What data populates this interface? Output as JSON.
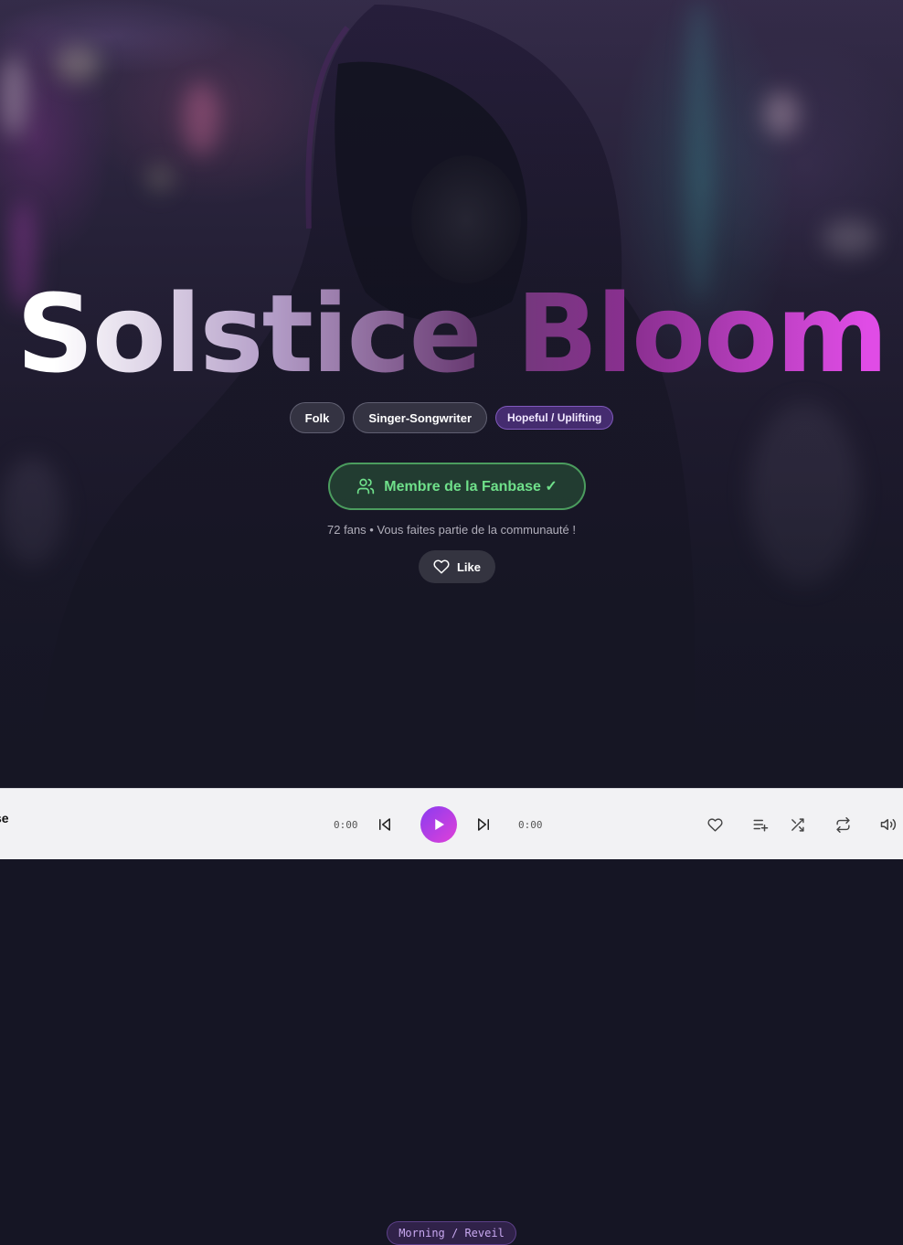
{
  "hero": {
    "title": "Solstice Bloom",
    "tags": [
      {
        "label": "Folk",
        "kind": "genre"
      },
      {
        "label": "Singer-Songwriter",
        "kind": "genre"
      },
      {
        "label": "Hopeful / Uplifting",
        "kind": "mood"
      },
      {
        "label": "Morning / Reveil",
        "kind": "time"
      }
    ],
    "fanbase_button": "Membre de la Fanbase ✓",
    "fanbase_note": "72 fans • Vous faites partie de la communauté !",
    "like_button": "Like"
  },
  "player": {
    "track_title_fragment": "se",
    "current_time": "0:00",
    "duration": "0:00"
  },
  "colors": {
    "accent_gradient_start": "#8a3cf0",
    "accent_gradient_end": "#e040d8",
    "fanbase_green": "#6fe08a",
    "mood_tag": "#503282"
  },
  "icons": {
    "fanbase": "users-icon",
    "like": "heart-icon",
    "prev": "skip-back-icon",
    "play": "play-icon",
    "next": "skip-forward-icon",
    "favorite": "heart-icon",
    "queue": "add-to-queue-icon",
    "shuffle": "shuffle-icon",
    "repeat": "repeat-icon",
    "volume": "volume-icon"
  }
}
